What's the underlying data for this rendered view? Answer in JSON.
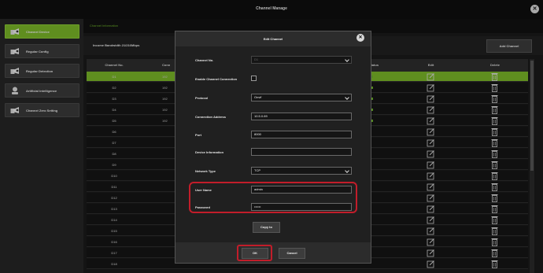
{
  "window": {
    "title": "Channel Manage",
    "close_glyph": "✕"
  },
  "sidebar": {
    "items": [
      {
        "label": "Channel Device",
        "icon": "camera-icon",
        "active": true
      },
      {
        "label": "Regular Config",
        "icon": "camera-icon",
        "active": false
      },
      {
        "label": "Regular Detection",
        "icon": "camera-icon",
        "active": false
      },
      {
        "label": "Artificial Intelligence",
        "icon": "ai-robot-icon",
        "active": false
      },
      {
        "label": "Channel Zero Setting",
        "icon": "camera-icon",
        "active": false
      }
    ]
  },
  "main": {
    "tab_label": "Channel Information",
    "bandwidth_label": "Income Bandwidth 21/216Mbps",
    "add_button": "Add Channel"
  },
  "table": {
    "headers": [
      "Channel No.",
      "Conn",
      "Status",
      "Edit",
      "Delete"
    ],
    "rows": [
      {
        "no": "D1",
        "ip": "192",
        "selected": true
      },
      {
        "no": "D2",
        "ip": "192",
        "selected": false
      },
      {
        "no": "D3",
        "ip": "192",
        "selected": false
      },
      {
        "no": "D4",
        "ip": "192",
        "selected": false
      },
      {
        "no": "D5",
        "ip": "192",
        "selected": false
      },
      {
        "no": "D6",
        "ip": "",
        "selected": false
      },
      {
        "no": "D7",
        "ip": "",
        "selected": false
      },
      {
        "no": "D8",
        "ip": "",
        "selected": false
      },
      {
        "no": "D9",
        "ip": "",
        "selected": false
      },
      {
        "no": "D10",
        "ip": "",
        "selected": false
      },
      {
        "no": "D11",
        "ip": "",
        "selected": false
      },
      {
        "no": "D12",
        "ip": "",
        "selected": false
      },
      {
        "no": "D13",
        "ip": "",
        "selected": false
      },
      {
        "no": "D14",
        "ip": "",
        "selected": false
      },
      {
        "no": "D15",
        "ip": "",
        "selected": false
      },
      {
        "no": "D16",
        "ip": "",
        "selected": false
      },
      {
        "no": "D17",
        "ip": "",
        "selected": false
      },
      {
        "no": "D18",
        "ip": "",
        "selected": false
      }
    ]
  },
  "dialog": {
    "title": "Edit Channel",
    "close_glyph": "✕",
    "fields": {
      "channel_no": {
        "label": "Channel No.",
        "value": "D1"
      },
      "enable_connection": {
        "label": "Enable Channel Connection",
        "checked": false
      },
      "protocol": {
        "label": "Protocol",
        "value": "Onvif"
      },
      "connection_address": {
        "label": "Connection Address",
        "value": "10.5.0.69"
      },
      "port": {
        "label": "Port",
        "value": "8000"
      },
      "device_information": {
        "label": "Device Information",
        "value": ""
      },
      "network_type": {
        "label": "Network Type",
        "value": "TCP"
      },
      "user_name": {
        "label": "User Name",
        "value": "admin"
      },
      "password": {
        "label": "Password",
        "value": "••••••"
      }
    },
    "copy_button": "Copy to",
    "ok_button": "OK",
    "cancel_button": "Cancel"
  },
  "colors": {
    "accent": "#7ab728",
    "highlight": "#c21d2a"
  }
}
